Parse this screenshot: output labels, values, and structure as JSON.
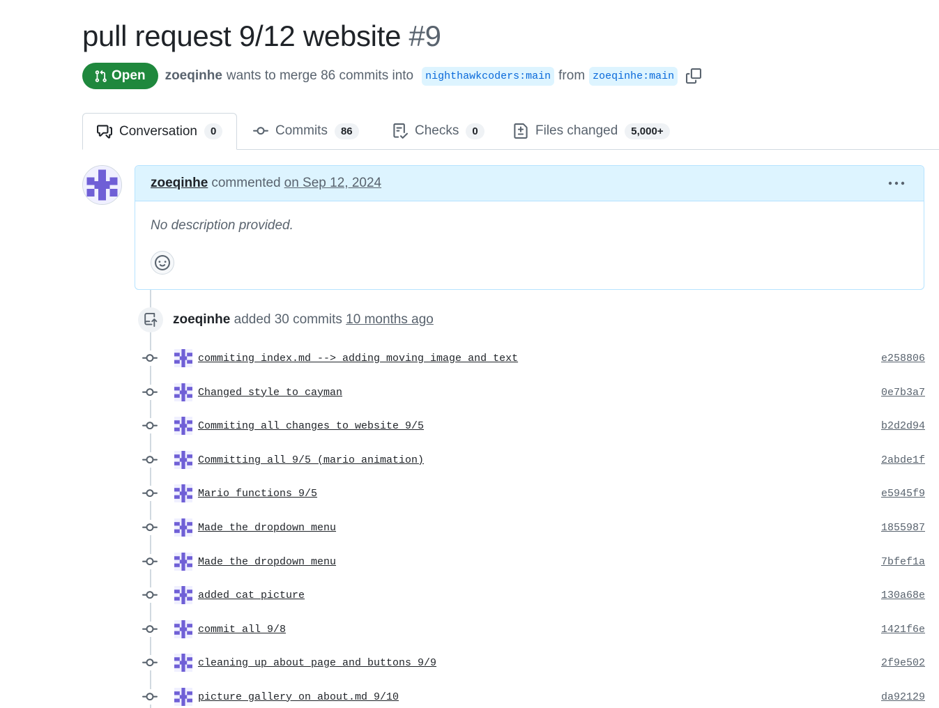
{
  "pr": {
    "title": "pull request 9/12 website",
    "number": "#9",
    "state": "Open",
    "author": "zoeqinhe",
    "merge_text": "wants to merge 86 commits into",
    "base_branch": "nighthawkcoders:main",
    "from_text": "from",
    "head_branch": "zoeqinhe:main"
  },
  "tabs": [
    {
      "label": "Conversation",
      "count": "0",
      "icon": "comment-discussion-icon"
    },
    {
      "label": "Commits",
      "count": "86",
      "icon": "git-commit-icon"
    },
    {
      "label": "Checks",
      "count": "0",
      "icon": "checklist-icon"
    },
    {
      "label": "Files changed",
      "count": "5,000+",
      "icon": "file-diff-icon"
    }
  ],
  "comment": {
    "author": "zoeqinhe",
    "verb": "commented",
    "date": "on Sep 12, 2024",
    "body": "No description provided."
  },
  "push": {
    "author": "zoeqinhe",
    "text": "added 30 commits",
    "time": "10 months ago"
  },
  "commits": [
    {
      "message": "commiting index.md --> adding moving image and text",
      "sha": "e258806"
    },
    {
      "message": "Changed style to cayman",
      "sha": "0e7b3a7"
    },
    {
      "message": "Commiting all changes to website 9/5",
      "sha": "b2d2d94"
    },
    {
      "message": "Committing all 9/5 (mario animation)",
      "sha": "2abde1f"
    },
    {
      "message": "Mario functions 9/5",
      "sha": "e5945f9"
    },
    {
      "message": "Made the dropdown menu",
      "sha": "1855987"
    },
    {
      "message": "Made the dropdown menu",
      "sha": "7bfef1a"
    },
    {
      "message": "added cat picture",
      "sha": "130a68e"
    },
    {
      "message": "commit all 9/8",
      "sha": "1421f6e"
    },
    {
      "message": "cleaning up about page and buttons 9/9",
      "sha": "2f9e502"
    },
    {
      "message": "picture gallery on about.md 9/10",
      "sha": "da92129"
    }
  ],
  "colors": {
    "open_green": "#1f883d",
    "link_blue": "#0969da",
    "header_blue": "#ddf4ff",
    "avatar_purple": "#6f5fd6"
  }
}
